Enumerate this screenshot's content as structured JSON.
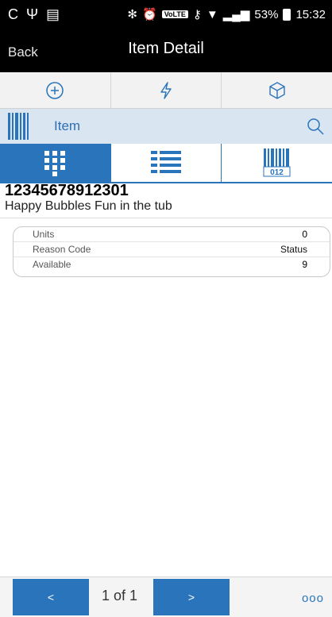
{
  "status_bar": {
    "left_icons": [
      "C",
      "Ψ",
      "▤"
    ],
    "lte": "VoLTE",
    "battery": "53%",
    "time": "15:32"
  },
  "header": {
    "back_label": "Back",
    "title": "Item Detail"
  },
  "toolbar": {
    "icons": [
      "add-circle-icon",
      "lightning-icon",
      "cube-icon"
    ]
  },
  "item_bar": {
    "label": "Item"
  },
  "tabs": [
    {
      "name": "keypad-tab",
      "icon": "keypad-icon",
      "active": true
    },
    {
      "name": "list-tab",
      "icon": "list-icon",
      "active": false
    },
    {
      "name": "barcode-tab",
      "icon": "barcode-icon",
      "badge": "012",
      "active": false
    }
  ],
  "item": {
    "sku": "12345678912301",
    "description": "Happy Bubbles Fun in the tub"
  },
  "details": [
    {
      "label": "Units",
      "value": "0"
    },
    {
      "label": "Reason Code",
      "value": "Status"
    },
    {
      "label": "Available",
      "value": "9"
    }
  ],
  "footer": {
    "prev_label": "<",
    "next_label": ">",
    "page": "1 of 1",
    "more": "ooo"
  },
  "colors": {
    "accent": "#2a74bb",
    "item_bar_bg": "#d9e6f1",
    "header_bg": "#000000"
  }
}
